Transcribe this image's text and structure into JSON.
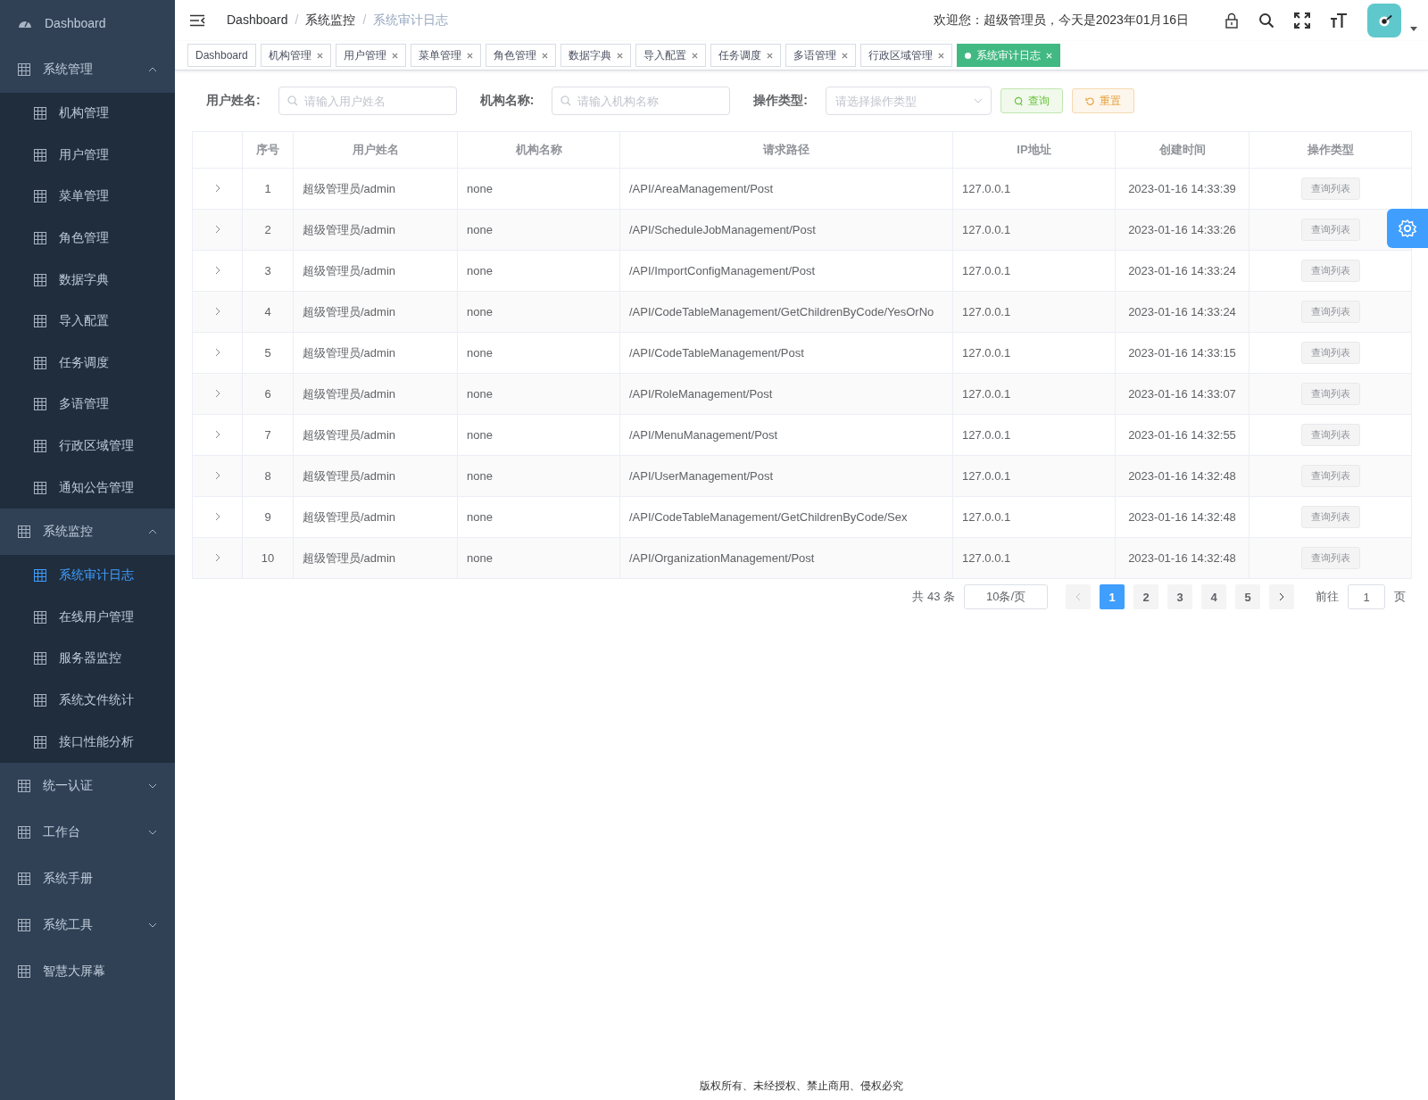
{
  "sidebar": {
    "items": [
      {
        "label": "Dashboard",
        "kind": "dashboard"
      },
      {
        "label": "系统管理",
        "kind": "group",
        "expanded": true,
        "children": [
          {
            "label": "机构管理",
            "selected": false
          },
          {
            "label": "用户管理",
            "selected": false
          },
          {
            "label": "菜单管理",
            "selected": false
          },
          {
            "label": "角色管理",
            "selected": false
          },
          {
            "label": "数据字典",
            "selected": false
          },
          {
            "label": "导入配置",
            "selected": false
          },
          {
            "label": "任务调度",
            "selected": false
          },
          {
            "label": "多语管理",
            "selected": false
          },
          {
            "label": "行政区域管理",
            "selected": false
          },
          {
            "label": "通知公告管理",
            "selected": false
          }
        ]
      },
      {
        "label": "系统监控",
        "kind": "group",
        "expanded": true,
        "children": [
          {
            "label": "系统审计日志",
            "selected": true
          },
          {
            "label": "在线用户管理",
            "selected": false
          },
          {
            "label": "服务器监控",
            "selected": false
          },
          {
            "label": "系统文件统计",
            "selected": false
          },
          {
            "label": "接口性能分析",
            "selected": false
          }
        ]
      },
      {
        "label": "统一认证",
        "kind": "group",
        "expanded": false
      },
      {
        "label": "工作台",
        "kind": "group",
        "expanded": false
      },
      {
        "label": "系统手册",
        "kind": "link"
      },
      {
        "label": "系统工具",
        "kind": "group",
        "expanded": false
      },
      {
        "label": "智慧大屏幕",
        "kind": "link"
      }
    ]
  },
  "breadcrumb": [
    "Dashboard",
    "系统监控",
    "系统审计日志"
  ],
  "breadcrumb_separator": "/",
  "welcome": "欢迎您：超级管理员，今天是2023年01月16日",
  "tabs": [
    {
      "label": "Dashboard",
      "closable": false,
      "selected": false
    },
    {
      "label": "机构管理",
      "closable": true,
      "selected": false
    },
    {
      "label": "用户管理",
      "closable": true,
      "selected": false
    },
    {
      "label": "菜单管理",
      "closable": true,
      "selected": false
    },
    {
      "label": "角色管理",
      "closable": true,
      "selected": false
    },
    {
      "label": "数据字典",
      "closable": true,
      "selected": false
    },
    {
      "label": "导入配置",
      "closable": true,
      "selected": false
    },
    {
      "label": "任务调度",
      "closable": true,
      "selected": false
    },
    {
      "label": "多语管理",
      "closable": true,
      "selected": false
    },
    {
      "label": "行政区域管理",
      "closable": true,
      "selected": false
    },
    {
      "label": "系统审计日志",
      "closable": true,
      "selected": true
    }
  ],
  "filters": [
    {
      "label": "用户姓名:",
      "kind": "input",
      "placeholder": "请输入用户姓名"
    },
    {
      "label": "机构名称:",
      "kind": "input",
      "placeholder": "请输入机构名称"
    },
    {
      "label": "操作类型:",
      "kind": "select",
      "placeholder": "请选择操作类型"
    }
  ],
  "buttons": [
    {
      "label": "查询",
      "kind": "search"
    },
    {
      "label": "重置",
      "kind": "reset"
    }
  ],
  "table": {
    "columns": [
      "序号",
      "用户姓名",
      "机构名称",
      "请求路径",
      "IP地址",
      "创建时间",
      "操作类型"
    ],
    "rows": [
      [
        "1",
        "超级管理员/admin",
        "none",
        "/API/AreaManagement/Post",
        "127.0.0.1",
        "2023-01-16 14:33:39",
        "查询列表"
      ],
      [
        "2",
        "超级管理员/admin",
        "none",
        "/API/ScheduleJobManagement/Post",
        "127.0.0.1",
        "2023-01-16 14:33:26",
        "查询列表"
      ],
      [
        "3",
        "超级管理员/admin",
        "none",
        "/API/ImportConfigManagement/Post",
        "127.0.0.1",
        "2023-01-16 14:33:24",
        "查询列表"
      ],
      [
        "4",
        "超级管理员/admin",
        "none",
        "/API/CodeTableManagement/GetChildrenByCode/YesOrNo",
        "127.0.0.1",
        "2023-01-16 14:33:24",
        "查询列表"
      ],
      [
        "5",
        "超级管理员/admin",
        "none",
        "/API/CodeTableManagement/Post",
        "127.0.0.1",
        "2023-01-16 14:33:15",
        "查询列表"
      ],
      [
        "6",
        "超级管理员/admin",
        "none",
        "/API/RoleManagement/Post",
        "127.0.0.1",
        "2023-01-16 14:33:07",
        "查询列表"
      ],
      [
        "7",
        "超级管理员/admin",
        "none",
        "/API/MenuManagement/Post",
        "127.0.0.1",
        "2023-01-16 14:32:55",
        "查询列表"
      ],
      [
        "8",
        "超级管理员/admin",
        "none",
        "/API/UserManagement/Post",
        "127.0.0.1",
        "2023-01-16 14:32:48",
        "查询列表"
      ],
      [
        "9",
        "超级管理员/admin",
        "none",
        "/API/CodeTableManagement/GetChildrenByCode/Sex",
        "127.0.0.1",
        "2023-01-16 14:32:48",
        "查询列表"
      ],
      [
        "10",
        "超级管理员/admin",
        "none",
        "/API/OrganizationManagement/Post",
        "127.0.0.1",
        "2023-01-16 14:32:48",
        "查询列表"
      ]
    ]
  },
  "pagination": {
    "total": "共 43 条",
    "page_size": "10条/页",
    "pages": [
      {
        "label": "1",
        "selected": true
      },
      {
        "label": "2",
        "selected": false
      },
      {
        "label": "3",
        "selected": false
      },
      {
        "label": "4",
        "selected": false
      },
      {
        "label": "5",
        "selected": false
      }
    ],
    "goto_label": "前往",
    "goto_value": "1",
    "page_suffix": "页"
  },
  "footer": "版权所有、未经授权、禁止商用、侵权必究"
}
